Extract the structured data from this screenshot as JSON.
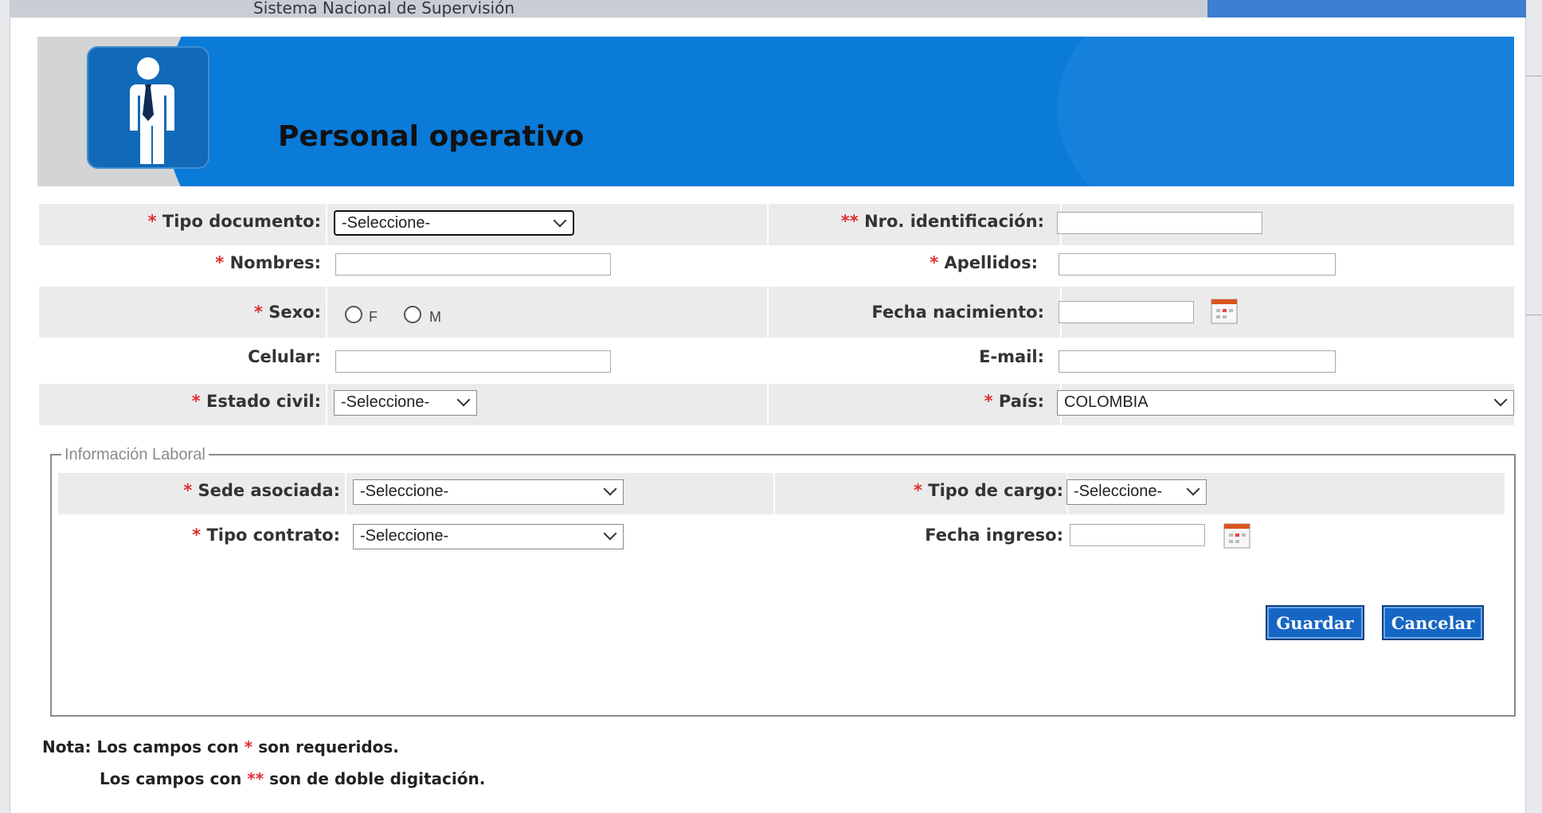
{
  "background": {
    "app_title": "Sistema Nacional de Supervisión"
  },
  "modal": {
    "title": "Personal operativo",
    "fields": {
      "tipo_documento": {
        "label": "Tipo documento:",
        "required": "*",
        "value": "-Seleccione-"
      },
      "nro_identificacion": {
        "label": "Nro. identificación:",
        "required": "**",
        "value": ""
      },
      "nombres": {
        "label": "Nombres:",
        "required": "*",
        "value": ""
      },
      "apellidos": {
        "label": "Apellidos:",
        "required": "*",
        "value": ""
      },
      "sexo": {
        "label": "Sexo:",
        "required": "*",
        "option_f": "F",
        "option_m": "M"
      },
      "fecha_nacimiento": {
        "label": "Fecha nacimiento:",
        "value": ""
      },
      "celular": {
        "label": "Celular:",
        "value": ""
      },
      "email": {
        "label": "E-mail:",
        "value": ""
      },
      "estado_civil": {
        "label": "Estado civil:",
        "required": "*",
        "value": "-Seleccione-"
      },
      "pais": {
        "label": "País:",
        "required": "*",
        "value": "COLOMBIA"
      }
    },
    "laboral": {
      "legend": "Información Laboral",
      "sede_asociada": {
        "label": "Sede asociada:",
        "required": "*",
        "value": "-Seleccione-"
      },
      "tipo_cargo": {
        "label": "Tipo de cargo:",
        "required": "*",
        "value": "-Seleccione-"
      },
      "tipo_contrato": {
        "label": "Tipo contrato:",
        "required": "*",
        "value": "-Seleccione-"
      },
      "fecha_ingreso": {
        "label": "Fecha ingreso:",
        "value": ""
      }
    },
    "buttons": {
      "save": "Guardar",
      "cancel": "Cancelar"
    },
    "notes": {
      "prefix": "Nota:",
      "line1_a": "Los campos con",
      "line1_star": "*",
      "line1_b": "son requeridos.",
      "line2_a": "Los campos con",
      "line2_star": "**",
      "line2_b": "son de doble digitación."
    }
  },
  "colors": {
    "banner": "#0a7bd9",
    "required": "#e03030",
    "button": "#1666c5"
  },
  "icons": {
    "banner_icon": "person-tie-icon",
    "calendar": "calendar-icon",
    "dropdown": "chevron-down-icon"
  }
}
